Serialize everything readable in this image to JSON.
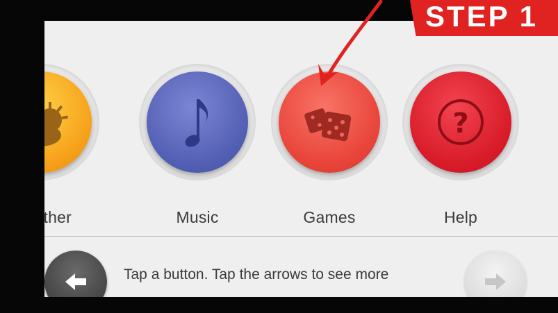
{
  "apps": [
    {
      "id": "weather",
      "label": "Weather",
      "icon": "weather-icon",
      "color": "#f7a21b"
    },
    {
      "id": "music",
      "label": "Music",
      "icon": "music-note-icon",
      "color": "#5460b4"
    },
    {
      "id": "games",
      "label": "Games",
      "icon": "dice-icon",
      "color": "#e9453a"
    },
    {
      "id": "help",
      "label": "Help",
      "icon": "question-mark-icon",
      "color": "#d91c2a"
    }
  ],
  "nav": {
    "instruction": "Tap a button. Tap the arrows to see more",
    "back_icon": "arrow-left-icon",
    "forward_icon": "arrow-right-icon"
  },
  "annotation": {
    "step_text": "STEP 1",
    "color": "#e02321"
  }
}
